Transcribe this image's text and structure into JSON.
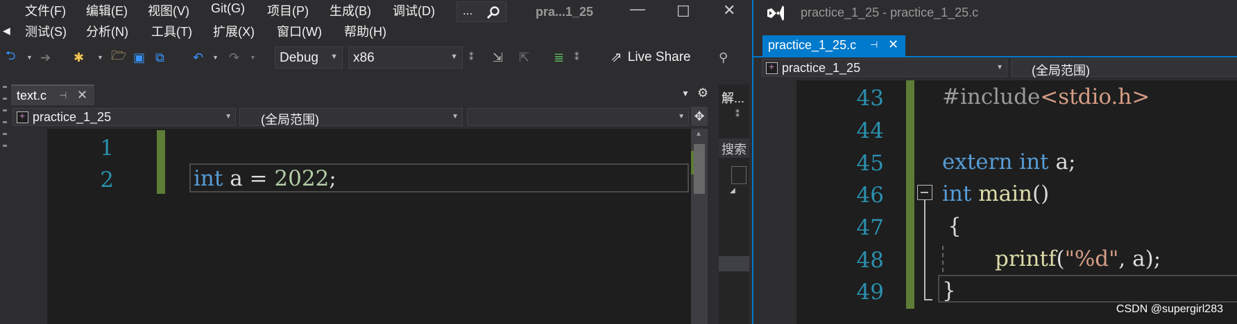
{
  "left_window": {
    "menu_row1": [
      "文件(F)",
      "编辑(E)",
      "视图(V)",
      "Git(G)",
      "项目(P)",
      "生成(B)",
      "调试(D)"
    ],
    "menu_row2": [
      "测试(S)",
      "分析(N)",
      "工具(T)",
      "扩展(X)",
      "窗口(W)",
      "帮助(H)"
    ],
    "quick_search": {
      "text": "...",
      "icon": "search-icon"
    },
    "solution_name": "pra...1_25",
    "window_controls": {
      "minimize": "—",
      "maximize": "☐",
      "close": "✕"
    },
    "toolbar": {
      "config": "Debug",
      "platform": "x86",
      "live_share": "Live Share",
      "icons": [
        "back-arrow-icon",
        "forward-arrow-icon",
        "new-project-icon",
        "open-folder-icon",
        "save-icon",
        "save-all-icon",
        "undo-icon",
        "redo-icon",
        "comment-icon",
        "uncomment-icon",
        "live-share-icon",
        "feedback-icon"
      ]
    },
    "document_tab": {
      "label": "text.c",
      "pin": "⊣",
      "close": "✕"
    },
    "navbar": {
      "project": "practice_1_25",
      "scope": "(全局范围)",
      "member": ""
    },
    "editor": {
      "line_numbers": [
        "1",
        "2"
      ],
      "code_line2": {
        "kw": "int",
        "rest": " a = ",
        "num": "2022",
        "end": ";"
      }
    },
    "side_panel": {
      "title": "解...",
      "search": "搜索"
    }
  },
  "right_window": {
    "title": "practice_1_25 - practice_1_25.c",
    "tab": {
      "label": "practice_1_25.c",
      "pin": "⊣",
      "close": "✕"
    },
    "navbar": {
      "project": "practice_1_25",
      "scope": "(全局范围)"
    },
    "line_numbers": [
      "43",
      "44",
      "45",
      "46",
      "47",
      "48",
      "49"
    ],
    "code": {
      "l43_directive": "#include",
      "l43_header": "<stdio.h>",
      "l45_kw1": "extern",
      "l45_kw2": "int",
      "l45_rest": " a;",
      "l46_kw": "int",
      "l46_fn": "main",
      "l46_rest": "()",
      "l47": "{",
      "l48_fn": "printf",
      "l48_open": "(",
      "l48_str": "\"%d\"",
      "l48_rest": ", a);",
      "l49": "}"
    },
    "watermark": "CSDN @supergirl283"
  }
}
